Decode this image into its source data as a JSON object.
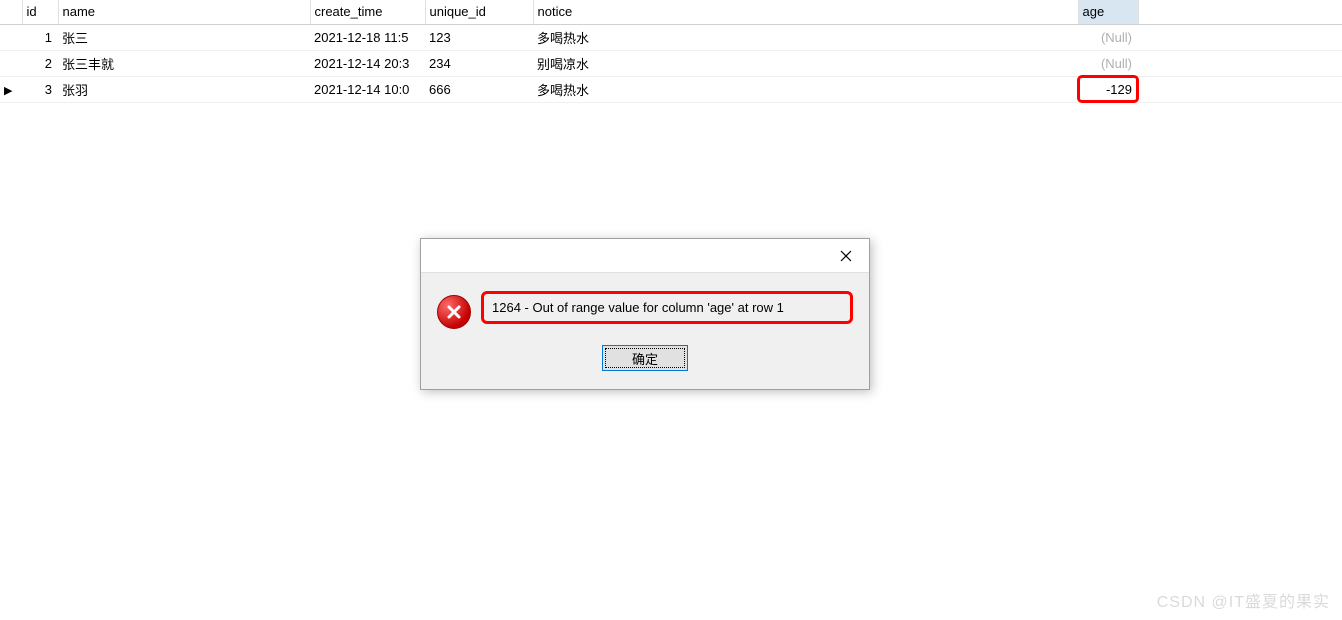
{
  "table": {
    "headers": {
      "id": "id",
      "name": "name",
      "create_time": "create_time",
      "unique_id": "unique_id",
      "notice": "notice",
      "age": "age"
    },
    "rows": [
      {
        "marker": "",
        "id": "1",
        "name": "张三",
        "create_time": "2021-12-18 11:5",
        "unique_id": "123",
        "notice": "多喝热水",
        "age": "(Null)",
        "age_null": true
      },
      {
        "marker": "",
        "id": "2",
        "name": "张三丰就",
        "create_time": "2021-12-14 20:3",
        "unique_id": "234",
        "notice": "别喝凉水",
        "age": "(Null)",
        "age_null": true
      },
      {
        "marker": "▶",
        "id": "3",
        "name": "张羽",
        "create_time": "2021-12-14 10:0",
        "unique_id": "666",
        "notice": "多喝热水",
        "age": "-129",
        "age_null": false,
        "age_highlight": true
      }
    ]
  },
  "dialog": {
    "message": "1264 - Out of range value for column 'age' at row 1",
    "ok_label": "确定"
  },
  "watermark": "CSDN @IT盛夏的果实"
}
